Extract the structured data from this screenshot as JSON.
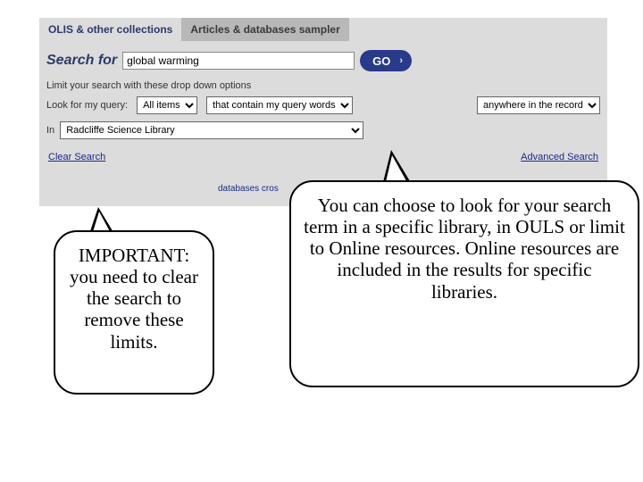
{
  "tabs": {
    "tab1": "OLIS & other collections",
    "tab2": "Articles & databases sampler"
  },
  "search": {
    "label": "Search for",
    "value": "global warming",
    "go": "GO"
  },
  "limit_text": "Limit your search with these drop down options",
  "row2": {
    "look_for": "Look for my query:",
    "sel_items": "All items",
    "sel_contain": "that contain my query words",
    "sel_where": "anywhere in the record"
  },
  "row3": {
    "in_label": "In",
    "sel_location": "Radcliffe Science Library"
  },
  "links": {
    "clear": "Clear Search",
    "advanced": "Advanced Search"
  },
  "footer": "databases cros",
  "callouts": {
    "small": "IMPORTANT: you need to clear the search to remove these limits.",
    "large": "You can choose to look for your search term in a specific library, in OULS or limit to Online resources.  Online resources are included in the results for specific libraries."
  }
}
